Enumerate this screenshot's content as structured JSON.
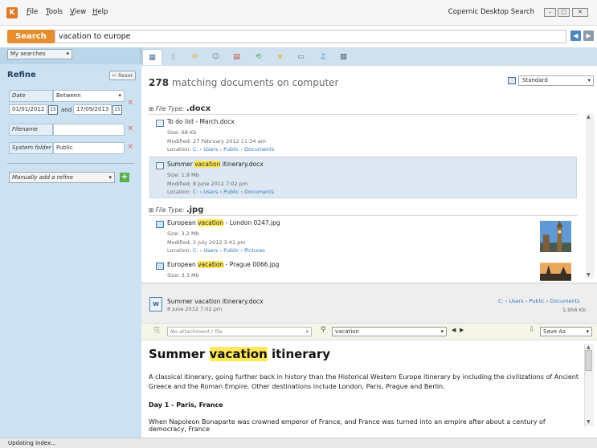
{
  "titlebar": {
    "logo": "K",
    "menus": [
      {
        "key": "F",
        "rest": "ile"
      },
      {
        "key": "T",
        "rest": "ools"
      },
      {
        "key": "V",
        "rest": "iew"
      },
      {
        "key": "H",
        "rest": "elp"
      }
    ],
    "app_title": "Copernic Desktop Search"
  },
  "search": {
    "button": "Search",
    "query": "vacation to europe"
  },
  "left": {
    "my_searches": "My searches",
    "refine_title": "Refine",
    "reset": "Reset",
    "date_label": "Date",
    "date_mode": "Between",
    "date_from": "01/01/2012",
    "date_and": "and",
    "date_to": "17/09/2013",
    "filename_label": "Filename",
    "filename_value": "",
    "system_folder_label": "System folder",
    "system_folder_value": "Public",
    "manual_add": "Manually add a refine",
    "cal_icon": "15"
  },
  "results": {
    "count": "278",
    "count_suffix": "matching documents on computer",
    "view": "Standard",
    "groups": [
      {
        "prefix": "File Type:",
        "name": ".docx"
      },
      {
        "prefix": "File Type:",
        "name": ".jpg"
      }
    ],
    "items": [
      {
        "name": "To do list - March.docx",
        "size": "Size: 68 Kb",
        "modified": "Modified: 27 February 2012  11:34 am",
        "loc_label": "Location:",
        "path": [
          "C:",
          "Users",
          "Public",
          "Documents"
        ]
      },
      {
        "name_pre": "Summer ",
        "name_hl": "vacation",
        "name_post": " itinerary.docx",
        "size": "Size: 1.9 Mb",
        "modified": "Modified: 8 June 2012  7:02 pm",
        "loc_label": "Location:",
        "path": [
          "C:",
          "Users",
          "Public",
          "Documents"
        ]
      },
      {
        "name_pre": "European ",
        "name_hl": "vacation",
        "name_post": " - London 0247.jpg",
        "size": "Size: 3.2 Mb",
        "modified": "Modified: 2 July 2012  3:41 pm",
        "loc_label": "Location:",
        "path": [
          "C:",
          "Users",
          "Public",
          "Pictures"
        ]
      },
      {
        "name_pre": "European ",
        "name_hl": "vacation",
        "name_post": " - Prague 0066.jpg",
        "size": "Size: 3.3 Mb"
      }
    ]
  },
  "preview": {
    "name": "Summer vacation itinerary.docx",
    "date": "8 June 2012  7:02 pm",
    "path": [
      "C:",
      "Users",
      "Public",
      "Documents"
    ],
    "size": "1,956 Kb",
    "attachment": "No attachment / file",
    "find": "vacation",
    "save_as": "Save As"
  },
  "doc": {
    "title_pre": "Summer ",
    "title_hl": "vacation",
    "title_post": " itinerary",
    "p1": "A classical itinerary, going further back in history than the Historical Western Europe itinerary by including the civilizations of Ancient Greece and the Roman Empire. Other destinations include London, Paris, Prague and Berlin.",
    "h1": "Day 1 - Paris, France",
    "p2": "When Napoleon Bonaparte was crowned emperor of France, and France was turned into an empire after about a century of democracy, France"
  },
  "status": "Updating index..."
}
